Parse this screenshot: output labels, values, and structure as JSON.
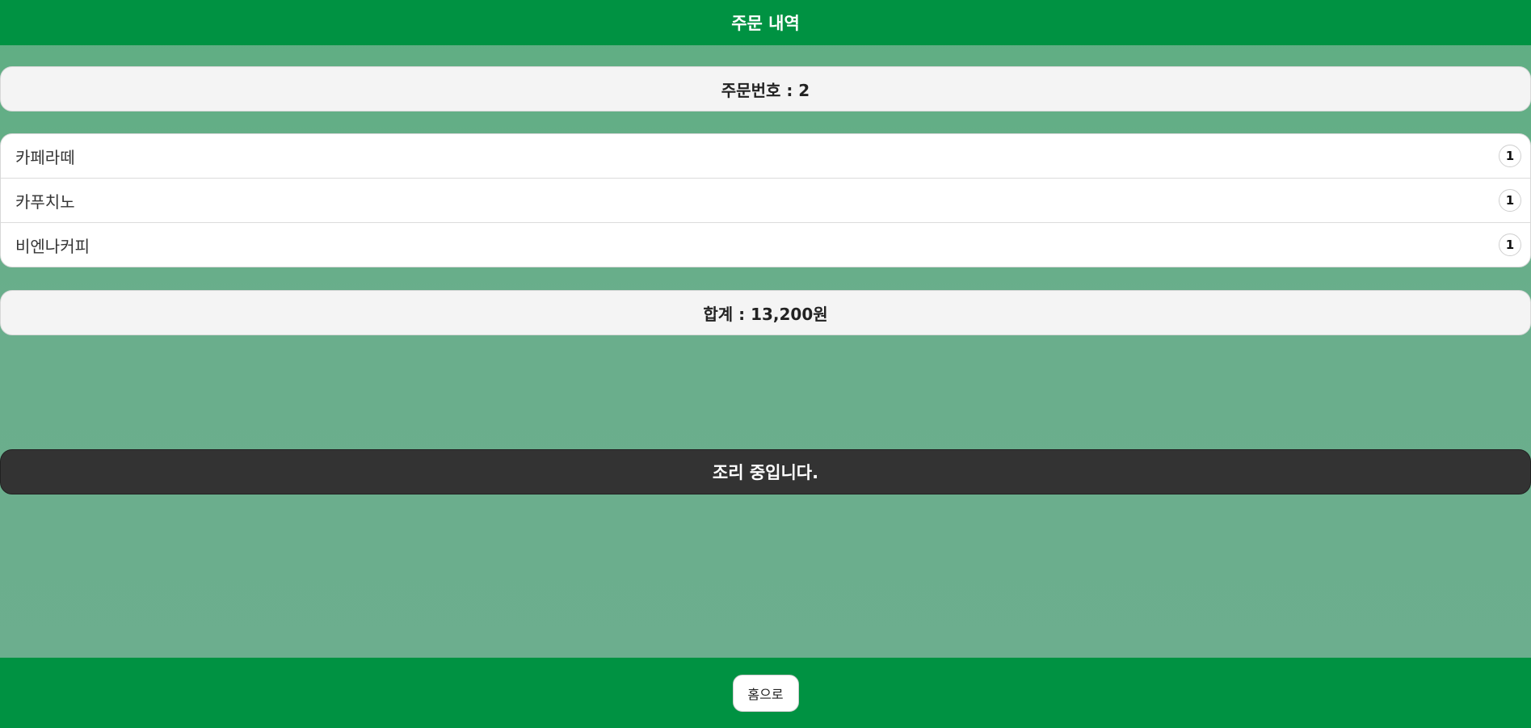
{
  "header": {
    "title": "주문 내역"
  },
  "order": {
    "number_label": "주문번호 : 2"
  },
  "items": [
    {
      "name": "카페라떼",
      "qty": "1"
    },
    {
      "name": "카푸치노",
      "qty": "1"
    },
    {
      "name": "비엔나커피",
      "qty": "1"
    }
  ],
  "total": {
    "label": "합계 : 13,200원"
  },
  "status": {
    "message": "조리 중입니다."
  },
  "footer": {
    "home_label": "홈으로"
  },
  "colors": {
    "brand_green": "#009242",
    "background": "#6aae8c",
    "status_dark": "#333333"
  }
}
